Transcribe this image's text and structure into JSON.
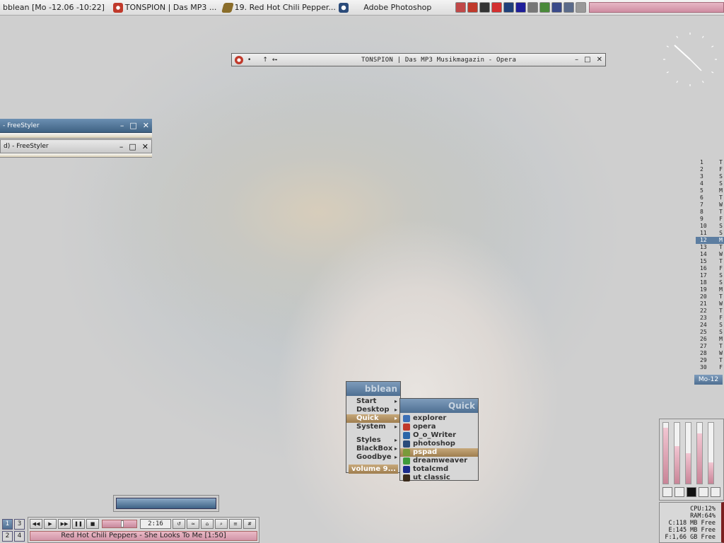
{
  "taskbar": {
    "clock": "bblean [Mo -12.06 -10:22]",
    "tasks": [
      {
        "label": "TONSPION | Das MP3 ...",
        "icon": "opera-icon",
        "color": "#c0392b"
      },
      {
        "label": "19. Red Hot Chili Pepper...",
        "icon": "winamp-icon",
        "color": "#8a6d2a"
      },
      {
        "label": "Adobe Photoshop",
        "icon": "photoshop-icon",
        "color": "#2b4b7a"
      }
    ],
    "tray_icons": [
      {
        "name": "tray-arrow-icon",
        "color": "#c04848"
      },
      {
        "name": "tray-opera-icon",
        "color": "#c0392b"
      },
      {
        "name": "tray-film-icon",
        "color": "#333333"
      },
      {
        "name": "tray-acrobat-icon",
        "color": "#d32f2f"
      },
      {
        "name": "tray-network-icon",
        "color": "#1e3f7a"
      },
      {
        "name": "tray-target-icon",
        "color": "#1e1e9a"
      },
      {
        "name": "tray-window-icon",
        "color": "#777777"
      },
      {
        "name": "tray-tree-icon",
        "color": "#4a8a3a"
      },
      {
        "name": "tray-monitor-icon",
        "color": "#3a4a8a"
      },
      {
        "name": "tray-speaker-icon",
        "color": "#5a6a8a"
      },
      {
        "name": "tray-messenger-icon",
        "color": "#999999"
      }
    ]
  },
  "opera_window": {
    "title": "TONSPION | Das MP3 Musikmagazin - Opera",
    "nav": [
      "•",
      "↑",
      "←̵"
    ],
    "buttons": {
      "minimize": "–",
      "maximize": "□",
      "close": "✕"
    }
  },
  "freestyler_windows": [
    {
      "title": "- FreeStyler"
    },
    {
      "title": "d) - FreeStyler"
    }
  ],
  "window_buttons": {
    "minimize": "–",
    "maximize": "□",
    "close": "✕"
  },
  "calendar": {
    "days": [
      {
        "d": "1",
        "w": "T"
      },
      {
        "d": "2",
        "w": "F"
      },
      {
        "d": "3",
        "w": "S"
      },
      {
        "d": "4",
        "w": "S"
      },
      {
        "d": "5",
        "w": "M"
      },
      {
        "d": "6",
        "w": "T"
      },
      {
        "d": "7",
        "w": "W"
      },
      {
        "d": "8",
        "w": "T"
      },
      {
        "d": "9",
        "w": "F"
      },
      {
        "d": "10",
        "w": "S"
      },
      {
        "d": "11",
        "w": "S"
      },
      {
        "d": "12",
        "w": "M",
        "today": true
      },
      {
        "d": "13",
        "w": "T"
      },
      {
        "d": "14",
        "w": "W"
      },
      {
        "d": "15",
        "w": "T"
      },
      {
        "d": "16",
        "w": "F"
      },
      {
        "d": "17",
        "w": "S"
      },
      {
        "d": "18",
        "w": "S"
      },
      {
        "d": "19",
        "w": "M"
      },
      {
        "d": "20",
        "w": "T"
      },
      {
        "d": "21",
        "w": "W"
      },
      {
        "d": "22",
        "w": "T"
      },
      {
        "d": "23",
        "w": "F"
      },
      {
        "d": "24",
        "w": "S"
      },
      {
        "d": "25",
        "w": "S"
      },
      {
        "d": "26",
        "w": "M"
      },
      {
        "d": "27",
        "w": "T"
      },
      {
        "d": "28",
        "w": "W"
      },
      {
        "d": "29",
        "w": "T"
      },
      {
        "d": "30",
        "w": "F"
      }
    ],
    "label": "Mo-12"
  },
  "main_menu": {
    "title": "bblean",
    "items": [
      {
        "label": "Start",
        "sub": true
      },
      {
        "label": "Desktop",
        "sub": true
      },
      {
        "label": "Quick",
        "sub": true,
        "active": true
      },
      {
        "label": "System",
        "sub": true
      },
      {
        "sep": true
      },
      {
        "label": "Styles",
        "sub": true
      },
      {
        "label": "BlackBox",
        "sub": true
      },
      {
        "label": "Goodbye",
        "sub": true
      }
    ],
    "volume": "volume 9..."
  },
  "quick_menu": {
    "title": "Quick",
    "items": [
      {
        "label": "explorer",
        "icon": "explorer-icon",
        "color": "#3b6fb6"
      },
      {
        "label": "opera",
        "icon": "opera-icon",
        "color": "#c0392b"
      },
      {
        "label": "O_o_Writer",
        "icon": "writer-icon",
        "color": "#2a66a8"
      },
      {
        "label": "photoshop",
        "icon": "photoshop-icon",
        "color": "#2b4b7a"
      },
      {
        "label": "pspad",
        "icon": "pspad-icon",
        "color": "#7a9a3a",
        "active": true
      },
      {
        "label": "dreamweaver",
        "icon": "dreamweaver-icon",
        "color": "#3e9a3a"
      },
      {
        "label": "totalcmd",
        "icon": "totalcmd-icon",
        "color": "#1a2a8a"
      },
      {
        "label": "ut classic",
        "icon": "ut-icon",
        "color": "#3a2a1a"
      }
    ]
  },
  "workspaces": [
    "1",
    "3",
    "2",
    "4"
  ],
  "player": {
    "buttons": [
      "◀◀",
      "▶",
      "▶▶",
      "❚❚",
      "■"
    ],
    "extra_buttons": [
      "↺",
      "≈",
      "⌂",
      "⌕",
      "≡",
      "#"
    ],
    "time": "2:16",
    "track": "Red Hot Chili Peppers - She Looks To Me [1:50]"
  },
  "meters": {
    "levels": [
      0.92,
      0.62,
      0.5,
      0.82,
      0.35
    ]
  },
  "sysinfo": {
    "cpu": "CPU:12%",
    "ram": "RAM:64%",
    "c": "C:118 MB Free",
    "e": "E:145 MB Free",
    "f": "F:1,66 GB Free"
  }
}
